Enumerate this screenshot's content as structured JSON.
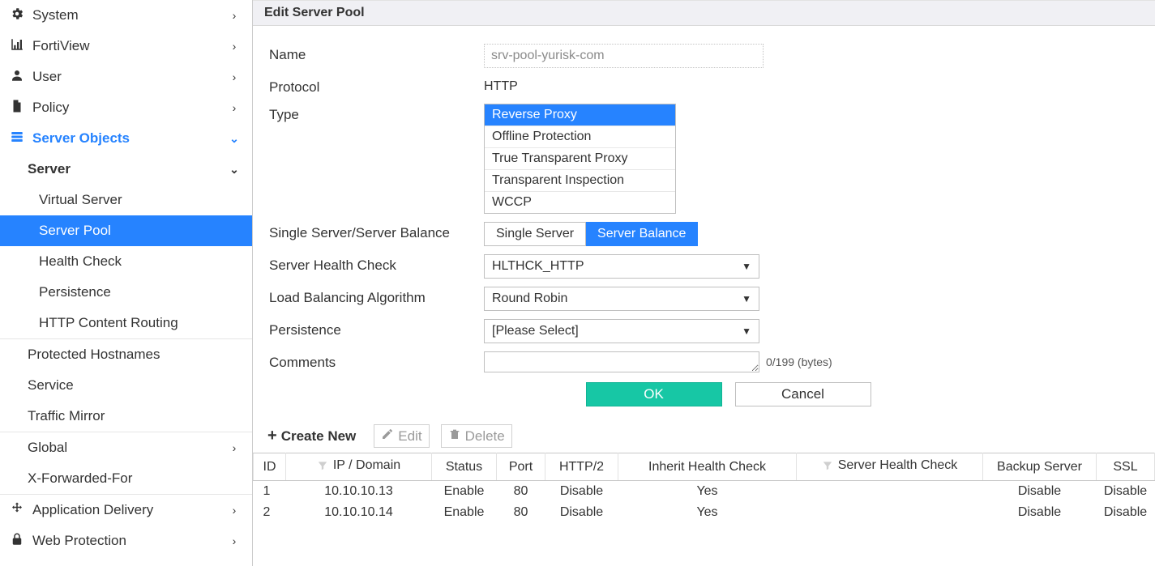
{
  "sidebar": {
    "items": [
      {
        "label": "System",
        "icon": "gear",
        "expandable": true
      },
      {
        "label": "FortiView",
        "icon": "chart",
        "expandable": true
      },
      {
        "label": "User",
        "icon": "user",
        "expandable": true
      },
      {
        "label": "Policy",
        "icon": "doc",
        "expandable": true
      },
      {
        "label": "Server Objects",
        "icon": "servers",
        "expandable": true,
        "active": true
      }
    ],
    "server_objects": {
      "server_label": "Server",
      "children": [
        {
          "label": "Virtual Server"
        },
        {
          "label": "Server Pool",
          "selected": true
        },
        {
          "label": "Health Check"
        },
        {
          "label": "Persistence"
        },
        {
          "label": "HTTP Content Routing"
        }
      ],
      "siblings": [
        {
          "label": "Protected Hostnames"
        },
        {
          "label": "Service"
        },
        {
          "label": "Traffic Mirror"
        },
        {
          "label": "Global",
          "expandable": true
        },
        {
          "label": "X-Forwarded-For"
        }
      ]
    },
    "bottom": [
      {
        "label": "Application Delivery",
        "icon": "move",
        "expandable": true
      },
      {
        "label": "Web Protection",
        "icon": "lock",
        "expandable": true
      }
    ]
  },
  "header": {
    "title": "Edit Server Pool"
  },
  "form": {
    "name_label": "Name",
    "name_value": "srv-pool-yurisk-com",
    "protocol_label": "Protocol",
    "protocol_value": "HTTP",
    "type_label": "Type",
    "type_options": [
      {
        "label": "Reverse Proxy",
        "selected": true
      },
      {
        "label": "Offline Protection"
      },
      {
        "label": "True Transparent Proxy"
      },
      {
        "label": "Transparent Inspection"
      },
      {
        "label": "WCCP"
      }
    ],
    "balance_label": "Single Server/Server Balance",
    "balance_options": {
      "single": "Single Server",
      "balance": "Server Balance"
    },
    "health_label": "Server Health Check",
    "health_value": "HLTHCK_HTTP",
    "algo_label": "Load Balancing Algorithm",
    "algo_value": "Round Robin",
    "persistence_label": "Persistence",
    "persistence_value": "[Please Select]",
    "comments_label": "Comments",
    "byte_count": "0/199 (bytes)",
    "ok_label": "OK",
    "cancel_label": "Cancel"
  },
  "toolbar": {
    "create_label": "Create New",
    "edit_label": "Edit",
    "delete_label": "Delete"
  },
  "table": {
    "headers": {
      "id": "ID",
      "ip": "IP / Domain",
      "status": "Status",
      "port": "Port",
      "http2": "HTTP/2",
      "inherit": "Inherit Health Check",
      "shc": "Server Health Check",
      "backup": "Backup Server",
      "ssl": "SSL"
    },
    "rows": [
      {
        "id": "1",
        "ip": "10.10.10.13",
        "status": "Enable",
        "port": "80",
        "http2": "Disable",
        "inherit": "Yes",
        "shc": "",
        "backup": "Disable",
        "ssl": "Disable"
      },
      {
        "id": "2",
        "ip": "10.10.10.14",
        "status": "Enable",
        "port": "80",
        "http2": "Disable",
        "inherit": "Yes",
        "shc": "",
        "backup": "Disable",
        "ssl": "Disable"
      }
    ]
  }
}
